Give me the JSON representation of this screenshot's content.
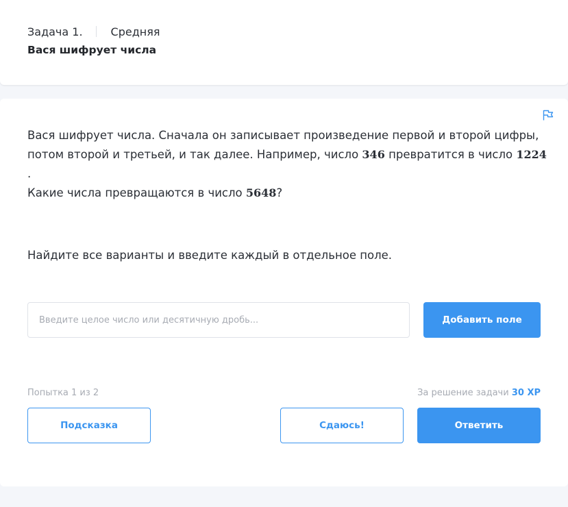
{
  "header": {
    "task_number": "Задача 1.",
    "difficulty": "Средняя",
    "title": "Вася шифрует числа"
  },
  "problem": {
    "line1_a": "Вася шифрует числа. Сначала он записывает произведение первой и второй цифры, потом второй и третьей, и так далее. Например, число ",
    "example_input": "346",
    "line1_b": " превратится в число ",
    "example_output": "1224",
    "line1_c": ".",
    "question_a": "Какие числа превращаются в число ",
    "target": "5648",
    "question_b": "?",
    "instruction": "Найдите все варианты и введите каждый в отдельное поле."
  },
  "answer": {
    "placeholder": "Введите целое число или десятичную дробь...",
    "value": "",
    "add_field_label": "Добавить поле"
  },
  "footer": {
    "attempt": "Попытка 1 из 2",
    "reward_prefix": "За решение задачи ",
    "reward_xp": "30 XP",
    "hint_label": "Подсказка",
    "giveup_label": "Сдаюсь!",
    "submit_label": "Ответить"
  },
  "icons": {
    "report": "flag-icon"
  },
  "colors": {
    "accent": "#3b95f0",
    "muted": "#a7abb3",
    "background": "#f4f6fa"
  }
}
